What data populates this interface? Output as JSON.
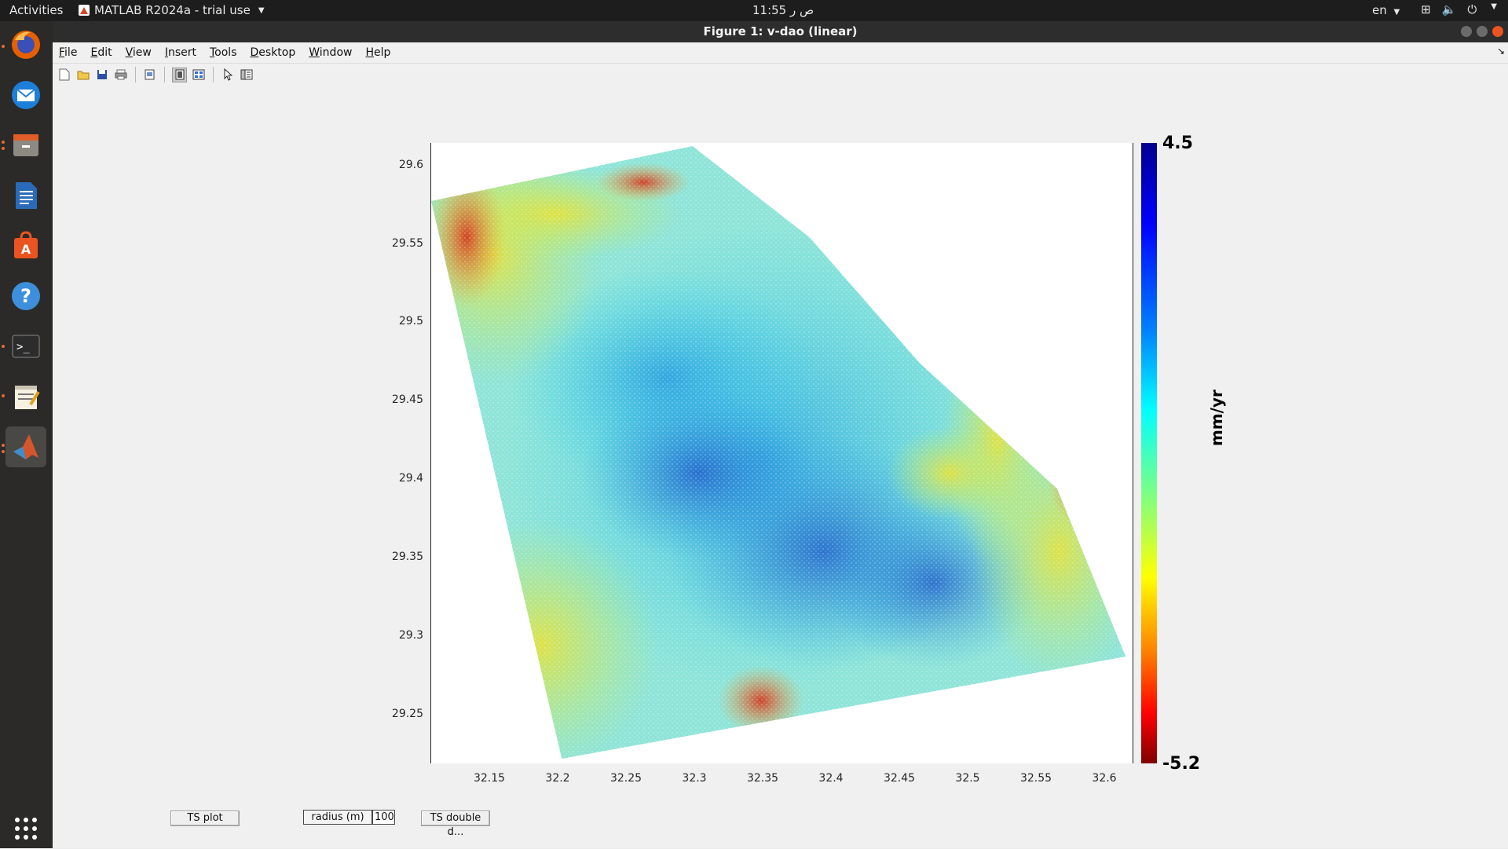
{
  "topbar": {
    "activities": "Activities",
    "app_name": "MATLAB R2024a - trial use",
    "clock": "11:55 ص ر",
    "lang": "en"
  },
  "dock": {
    "items": [
      "firefox-icon",
      "thunderbird-icon",
      "files-icon",
      "writer-icon",
      "software-icon",
      "help-icon",
      "terminal-icon",
      "text-editor-icon",
      "matlab-icon"
    ],
    "show_apps": "show-applications-icon"
  },
  "window": {
    "title": "Figure 1: v-dao (linear)"
  },
  "menu": [
    "File",
    "Edit",
    "View",
    "Insert",
    "Tools",
    "Desktop",
    "Window",
    "Help"
  ],
  "menu_mnemonics": [
    "F",
    "E",
    "V",
    "I",
    "T",
    "D",
    "W",
    "H"
  ],
  "toolbar": [
    "new-figure-icon",
    "open-icon",
    "save-icon",
    "print-icon",
    "print-preview-icon",
    "dock-toggle-icon",
    "plot-tools-icon",
    "pointer-icon",
    "property-inspector-icon"
  ],
  "chart_data": {
    "type": "scatter",
    "title": "",
    "x_ticks": [
      "32.15",
      "32.2",
      "32.25",
      "32.3",
      "32.35",
      "32.4",
      "32.45",
      "32.5",
      "32.55",
      "32.6"
    ],
    "y_ticks": [
      "29.6",
      "29.55",
      "29.5",
      "29.45",
      "29.4",
      "29.35",
      "29.3",
      "29.25"
    ],
    "xlim": [
      32.105,
      32.615
    ],
    "ylim": [
      29.205,
      29.6
    ],
    "colorbar": {
      "max": "4.5",
      "min": "-5.2",
      "label": "mm/yr",
      "colormap": "jet-reversed"
    },
    "footprint": [
      [
        32.105,
        29.563
      ],
      [
        32.295,
        29.598
      ],
      [
        32.38,
        29.54
      ],
      [
        32.46,
        29.46
      ],
      [
        32.56,
        29.38
      ],
      [
        32.61,
        29.273
      ],
      [
        32.2,
        29.208
      ]
    ]
  },
  "controls": {
    "ts_plot": "TS plot",
    "radius_label": "radius (m)",
    "radius_value": "100",
    "ts_double": "TS double d..."
  }
}
